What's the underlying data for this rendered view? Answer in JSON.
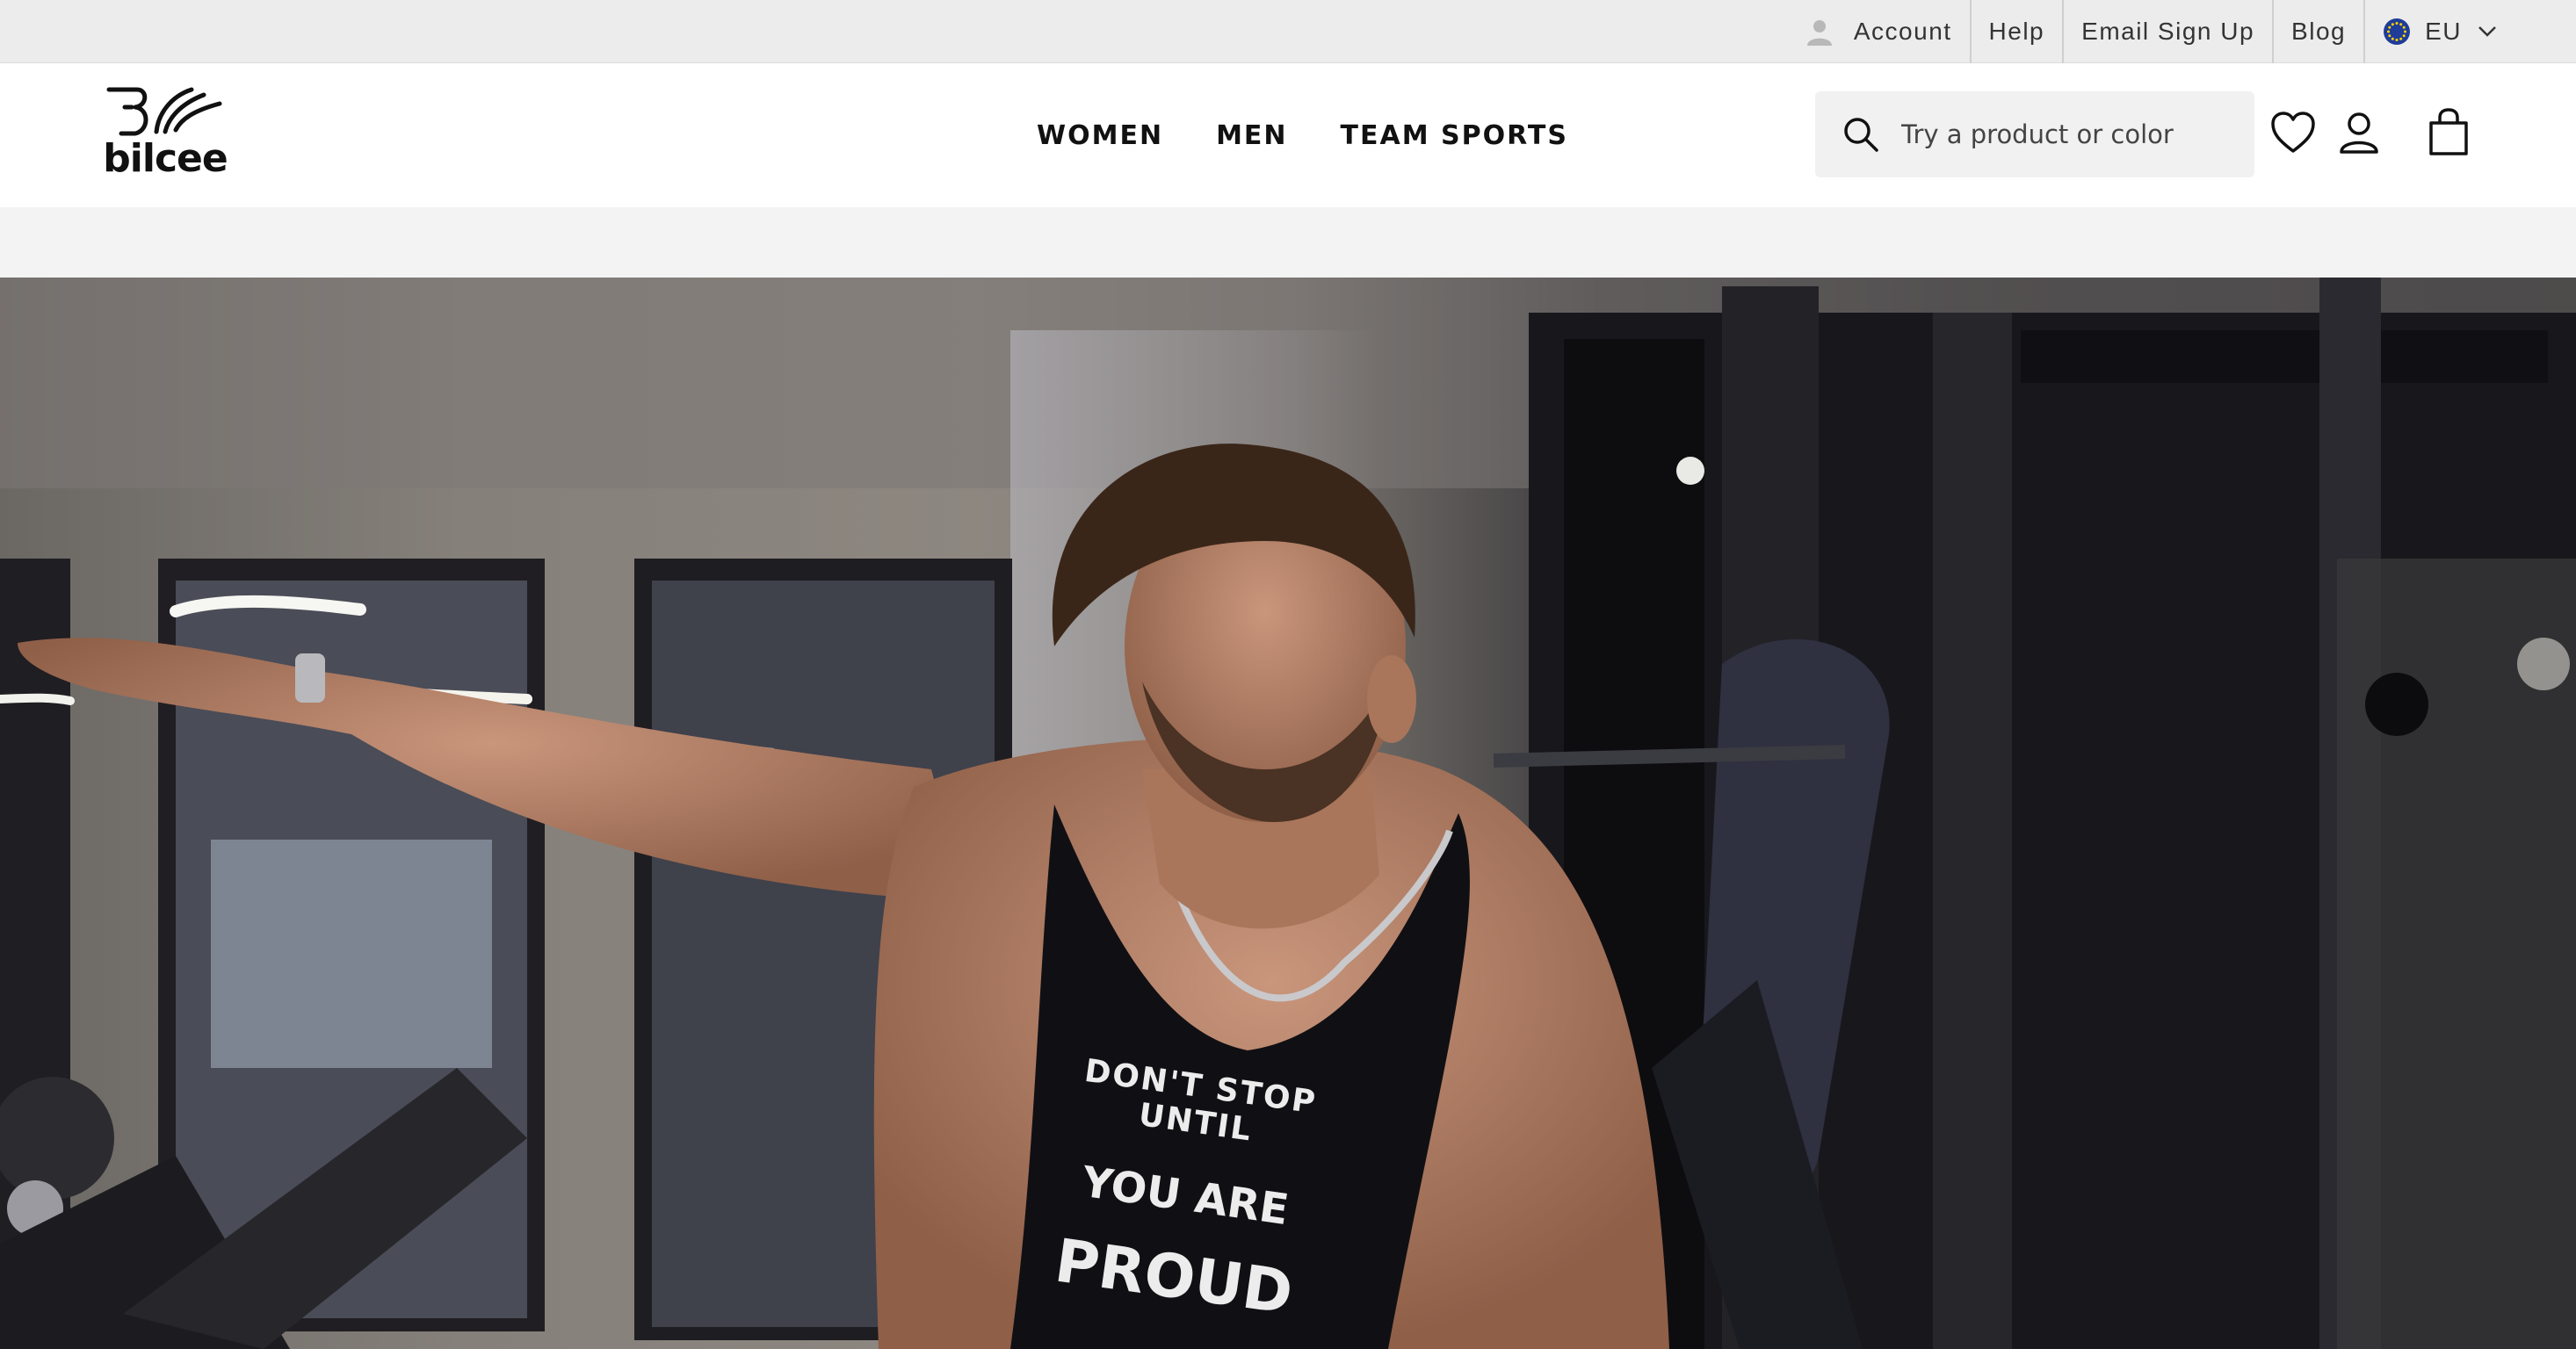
{
  "utility": {
    "account": "Account",
    "help": "Help",
    "email_signup": "Email Sign Up",
    "blog": "Blog",
    "region": "EU"
  },
  "brand": {
    "name": "bilcee"
  },
  "nav": {
    "items": [
      "WOMEN",
      "MEN",
      "TEAM SPORTS"
    ]
  },
  "search": {
    "placeholder": "Try a product or color"
  },
  "hero": {
    "shirt_lines": [
      "DON'T STOP UNTIL",
      "YOU ARE",
      "PROUD"
    ]
  },
  "icons": {
    "account": "user-silhouette-icon",
    "region": "eu-flag-icon",
    "search": "search-icon",
    "wishlist": "heart-icon",
    "user": "user-icon",
    "cart": "shopping-bag-icon"
  }
}
